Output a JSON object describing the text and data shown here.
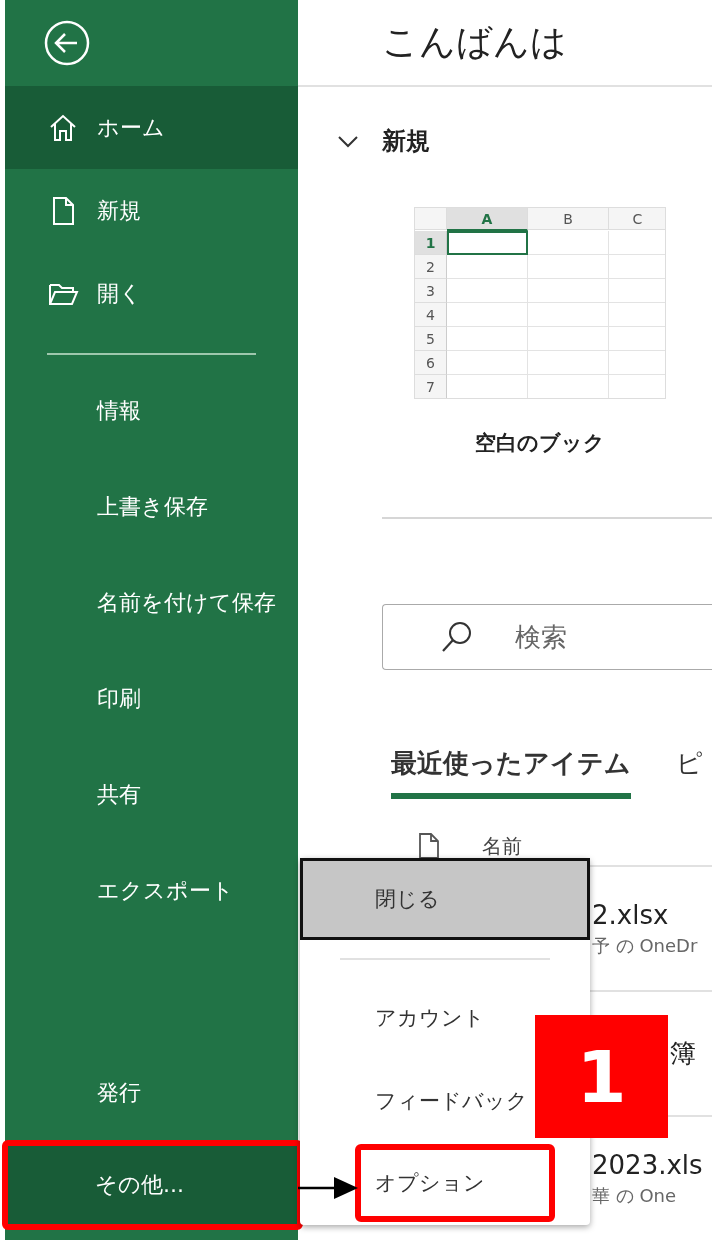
{
  "sidebar": {
    "top_items": [
      {
        "label": "ホーム",
        "selected": true,
        "highlighted": false
      },
      {
        "label": "新規",
        "selected": false,
        "highlighted": false
      },
      {
        "label": "開く",
        "selected": false,
        "highlighted": false
      }
    ],
    "middle_items": [
      {
        "label": "情報",
        "selected": false,
        "highlighted": false
      },
      {
        "label": "上書き保存",
        "selected": false,
        "highlighted": false
      },
      {
        "label": "名前を付けて保存",
        "selected": false,
        "highlighted": false
      },
      {
        "label": "印刷",
        "selected": false,
        "highlighted": false
      },
      {
        "label": "共有",
        "selected": false,
        "highlighted": false
      },
      {
        "label": "エクスポート",
        "selected": false,
        "highlighted": false
      }
    ],
    "bottom_items": [
      {
        "label": "発行",
        "selected": false,
        "highlighted": false
      },
      {
        "label": "その他...",
        "selected": true,
        "highlighted": true
      }
    ]
  },
  "header": {
    "greeting": "こんばんは"
  },
  "new_section": {
    "title": "新規",
    "expanded": true,
    "template": {
      "label": "空白のブック",
      "columns": [
        {
          "label": "A",
          "selected": true
        },
        {
          "label": "B",
          "selected": false
        },
        {
          "label": "C",
          "selected": false
        }
      ],
      "rows": [
        {
          "label": "1",
          "selected": true
        },
        {
          "label": "2",
          "selected": false
        },
        {
          "label": "3",
          "selected": false
        },
        {
          "label": "4",
          "selected": false
        },
        {
          "label": "5",
          "selected": false
        },
        {
          "label": "6",
          "selected": false
        },
        {
          "label": "7",
          "selected": false
        }
      ]
    }
  },
  "search": {
    "placeholder": "検索"
  },
  "tabs": [
    {
      "label": "最近使ったアイテム",
      "selected": true
    },
    {
      "label": "ピ",
      "selected": false
    }
  ],
  "file_list": {
    "column_header": "名前",
    "rows": [
      {
        "name": "2.xlsx",
        "location": "予 の OneDr"
      },
      {
        "name": "簿"
      },
      {
        "name": "2023.xls",
        "location": "華 の One"
      }
    ]
  },
  "menu": {
    "items": [
      {
        "label": "閉じる",
        "hovered": true,
        "highlighted": false,
        "divider_after": true
      },
      {
        "label": "アカウント",
        "hovered": false,
        "highlighted": false,
        "divider_after": false
      },
      {
        "label": "フィードバック",
        "hovered": false,
        "highlighted": false,
        "divider_after": false
      },
      {
        "label": "オプション",
        "hovered": false,
        "highlighted": true,
        "divider_after": false
      }
    ]
  },
  "step_badge": "1"
}
